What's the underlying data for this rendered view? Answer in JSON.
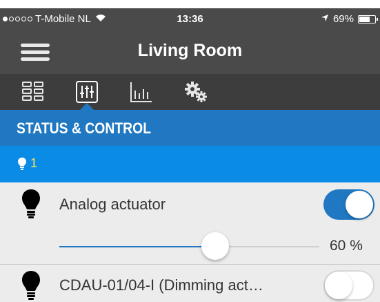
{
  "status_bar": {
    "carrier": "T-Mobile NL",
    "signal_bars_filled": 1,
    "signal_bars_total": 5,
    "time": "13:36",
    "battery": "69%",
    "battery_level": 0.69
  },
  "nav": {
    "title": "Living Room"
  },
  "tabs": [
    {
      "icon": "grid-icon",
      "active": false
    },
    {
      "icon": "sliders-icon",
      "active": true
    },
    {
      "icon": "bar-chart-icon",
      "active": false
    },
    {
      "icon": "gear-icon",
      "active": false
    }
  ],
  "section": {
    "title": "STATUS & CONTROL"
  },
  "group": {
    "icon": "bulb-icon",
    "count": "1"
  },
  "items": [
    {
      "icon": "bulb-icon",
      "label": "Analog actuator",
      "toggle_on": true,
      "slider_value": "60 %",
      "slider_fraction": 0.6
    },
    {
      "icon": "bulb-icon",
      "label": "CDAU-01/04-I  (Dimming act…",
      "toggle_on": false
    }
  ],
  "colors": {
    "header_dark": "#4a4a4a",
    "section_blue": "#1f78c1",
    "group_blue": "#0a8ce6",
    "group_text": "#ffe55a",
    "list_bg": "#ececec"
  }
}
